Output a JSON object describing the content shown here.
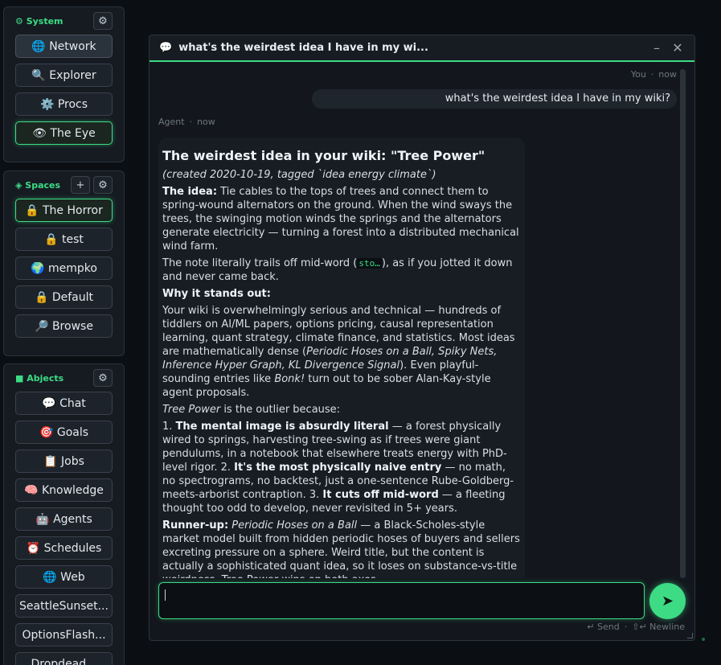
{
  "colors": {
    "accent": "#3ddc84",
    "background": "#0b0f13",
    "panel": "#161b22"
  },
  "system": {
    "title": "⚙ System",
    "gear": "⚙",
    "items": [
      {
        "icon": "🌐",
        "label": "Network"
      },
      {
        "icon": "🔍",
        "label": "Explorer"
      },
      {
        "icon": "⚙️",
        "label": "Procs"
      },
      {
        "icon": "👁",
        "label": "The Eye"
      }
    ]
  },
  "spaces": {
    "title": "◈ Spaces",
    "add": "+",
    "gear": "⚙",
    "items": [
      {
        "icon": "🔒",
        "label": "The Horror"
      },
      {
        "icon": "🔒",
        "label": "test"
      },
      {
        "icon": "🌍",
        "label": "mempko"
      },
      {
        "icon": "🔒",
        "label": "Default"
      },
      {
        "icon": "🔎",
        "label": "Browse"
      }
    ]
  },
  "abjects": {
    "title": "■ Abjects",
    "gear": "⚙",
    "items": [
      {
        "icon": "💬",
        "label": "Chat"
      },
      {
        "icon": "🎯",
        "label": "Goals"
      },
      {
        "icon": "📋",
        "label": "Jobs"
      },
      {
        "icon": "🧠",
        "label": "Knowledge"
      },
      {
        "icon": "🤖",
        "label": "Agents"
      },
      {
        "icon": "⏰",
        "label": "Schedules"
      },
      {
        "icon": "🌐",
        "label": "Web"
      },
      {
        "icon": "",
        "label": "SeattleSunset..."
      },
      {
        "icon": "",
        "label": "OptionsFlash..."
      },
      {
        "icon": "",
        "label": "Dropdead..."
      }
    ]
  },
  "window": {
    "icon": "💬",
    "title": "what's the weirdest idea I have in my wi...",
    "minimize": "–",
    "close": "✕"
  },
  "chat": {
    "user_meta": {
      "who": "You",
      "sep": "·",
      "when": "now"
    },
    "user_message": "what's the weirdest idea I have in my wiki?",
    "agent_meta": {
      "who": "Agent",
      "sep": "·",
      "when": "now"
    },
    "agent": {
      "heading": "The weirdest idea in your wiki: \"Tree Power\"",
      "created": "(created 2020-10-19, tagged `idea energy climate`)",
      "idea_label": "The idea:",
      "idea_text": " Tie cables to the tops of trees and connect them to spring-wound alternators on the ground. When the wind sways the trees, the swinging motion winds the springs and the alternators generate electricity — turning a forest into a distributed mechanical wind farm.",
      "trail_pre": "The note literally trails off mid-word (",
      "trail_code": "sto…",
      "trail_post": "), as if you jotted it down and never came back.",
      "why_label": "Why it stands out:",
      "why_text_1": "Your wiki is overwhelmingly serious and technical — hundreds of tiddlers on AI/ML papers, options pricing, causal representation learning, quant strategy, climate finance, and statistics. Most ideas are mathematically dense (",
      "why_italic": "Periodic Hoses on a Ball, Spiky Nets, Inference Hyper Graph, KL Divergence Signal",
      "why_text_2": "). Even playful-sounding entries like ",
      "why_bonk": "Bonk!",
      "why_text_3": " turn out to be sober Alan-Kay-style agent proposals.",
      "outlier_italic": "Tree Power",
      "outlier_text": " is the outlier because:",
      "reason1_pre": "1. ",
      "reason1_bold": "The mental image is absurdly literal",
      "reason1_text": " — a forest physically wired to springs, harvesting tree-swing as if trees were giant pendulums, in a notebook that elsewhere treats energy with PhD-level rigor. 2. ",
      "reason2_bold": "It's the most physically naive entry",
      "reason2_text": " — no math, no spectrograms, no backtest, just a one-sentence Rube-Goldberg-meets-arborist contraption. 3. ",
      "reason3_bold": "It cuts off mid-word",
      "reason3_text": " — a fleeting thought too odd to develop, never revisited in 5+ years.",
      "runner_label": "Runner-up:",
      "runner_italic": " Periodic Hoses on a Ball",
      "runner_text": " — a Black-Scholes-style market model built from hidden periodic hoses of buyers and sellers excreting pressure on a sphere. Weird title, but the content is actually a sophisticated quant idea, so it loses on substance-vs-title weirdness. Tree Power wins on both axes."
    },
    "input_value": "",
    "send_icon": "➤",
    "hint_send": "↵ Send",
    "hint_sep": "·",
    "hint_newline": "⇧↵ Newline"
  }
}
